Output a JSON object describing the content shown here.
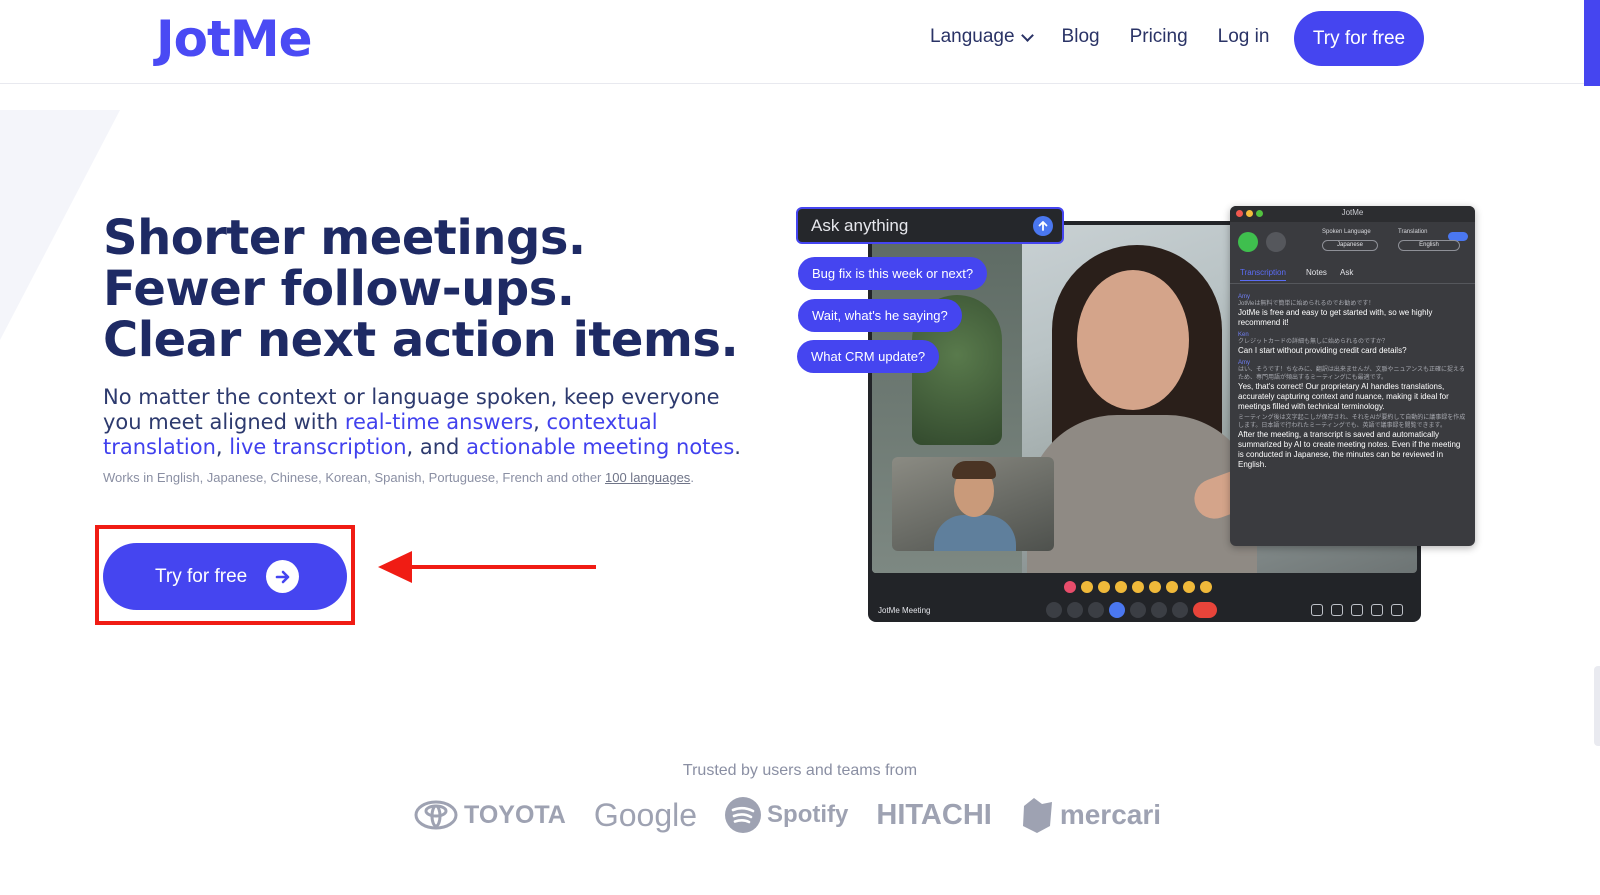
{
  "header": {
    "logo": "JotMe",
    "nav": {
      "language": "Language",
      "blog": "Blog",
      "pricing": "Pricing",
      "login": "Log in",
      "cta": "Try for free"
    }
  },
  "hero": {
    "headline": [
      "Shorter meetings.",
      "Fewer follow-ups.",
      "Clear next action items."
    ],
    "sub": {
      "p1": "No matter the context or language spoken, keep everyone you meet aligned with ",
      "h1": "real-time answers",
      "c1": ", ",
      "h2": "contextual translation",
      "c2": ", ",
      "h3": "live transcription",
      "c3": ", and ",
      "h4": "actionable meeting notes",
      "end": "."
    },
    "works_prefix": "Works in English, Japanese, Chinese, Korean, Spanish, Portuguese, French and other ",
    "works_link": "100 languages",
    "works_suffix": ".",
    "cta": "Try for free"
  },
  "mockup": {
    "ask_placeholder": "Ask anything",
    "chips": [
      "Bug fix is this week or next?",
      "Wait, what's he saying?",
      "What CRM update?"
    ],
    "meeting_label": "JotMe Meeting",
    "panel": {
      "title": "JotMe",
      "spoken_label": "Spoken Language",
      "spoken_value": "Japanese",
      "translation_label": "Translation",
      "translation_value": "English",
      "toggle": "ON",
      "tabs": [
        "Transcription",
        "Notes",
        "Ask"
      ],
      "entries": [
        {
          "speaker": "Amy",
          "orig": "JotMeは無料で簡単に始められるのでお勧めです！",
          "trans": "JotMe is free and easy to get started with, so we highly recommend it!"
        },
        {
          "speaker": "Ken",
          "orig": "クレジットカードの詳細も無しに始められるのですか？",
          "trans": "Can I start without providing credit card details?"
        },
        {
          "speaker": "Amy",
          "orig": "はい、そうです！ちなみに、翻訳は出来ませんが、文脈やニュアンスも正確に捉えるため、専門用語が頻出するミーティングにも最適です。",
          "trans": "Yes, that's correct! Our proprietary AI handles translations, accurately capturing context and nuance, making it ideal for meetings filled with technical terminology."
        },
        {
          "speaker": "",
          "orig": "ミーティング後は文字起こしが保存され、それをAIが要約して自動的に議事録を作成します。日本語で行われたミーティングでも、英語で議事録を閲覧できます。",
          "trans": "After the meeting, a transcript is saved and automatically summarized by AI to create meeting notes. Even if the meeting is conducted in Japanese, the minutes can be reviewed in English."
        }
      ]
    }
  },
  "trusted": {
    "label": "Trusted by users and teams from",
    "logos": [
      "TOYOTA",
      "Google",
      "Spotify",
      "HITACHI",
      "mercari"
    ]
  },
  "colors": {
    "brand": "#4545f0",
    "heading": "#1e2a64",
    "highlight_box": "#f01c14"
  }
}
